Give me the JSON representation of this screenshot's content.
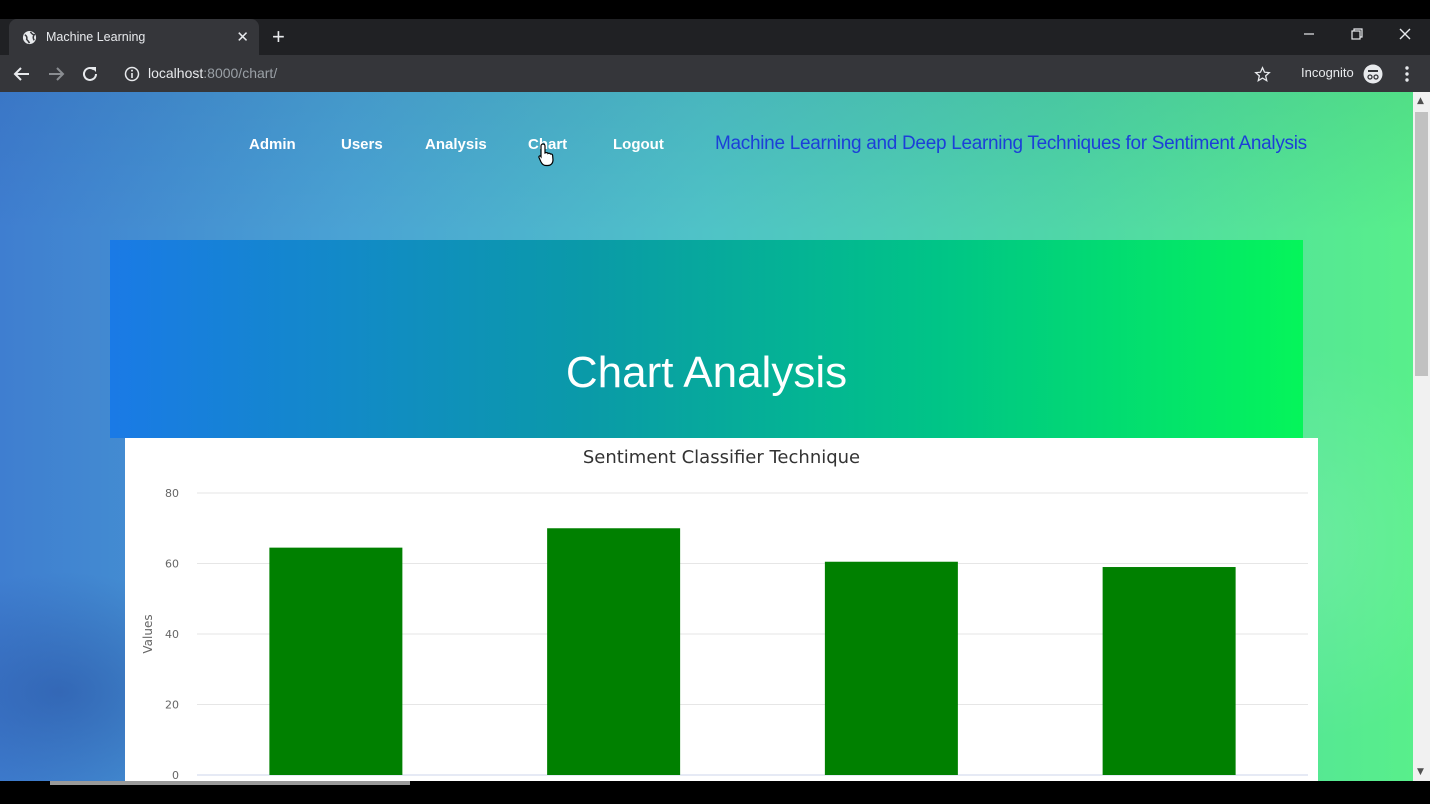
{
  "browser": {
    "tab_title": "Machine Learning",
    "new_tab_label": "+",
    "url_host": "localhost",
    "url_path": ":8000/chart/",
    "profile_label": "Incognito"
  },
  "nav": {
    "items": [
      {
        "label": "Admin"
      },
      {
        "label": "Users"
      },
      {
        "label": "Analysis"
      },
      {
        "label": "Chart"
      },
      {
        "label": "Logout"
      }
    ],
    "brand": "Machine Learning and Deep Learning Techniques for Sentiment Analysis"
  },
  "hero": {
    "title": "Chart Analysis"
  },
  "colors": {
    "bar": "#008000",
    "brand_text": "#1c3fd8",
    "hero_start": "#1a7ae6",
    "hero_end": "#05f55a"
  },
  "chart_data": {
    "type": "bar",
    "title": "Sentiment Classifier Technique",
    "ylabel": "Values",
    "xlabel": "",
    "ylim": [
      0,
      80
    ],
    "yticks": [
      0,
      20,
      40,
      60,
      80
    ],
    "categories": [
      "",
      "",
      "",
      ""
    ],
    "values": [
      64.5,
      70,
      60.5,
      59
    ],
    "grid": true
  }
}
